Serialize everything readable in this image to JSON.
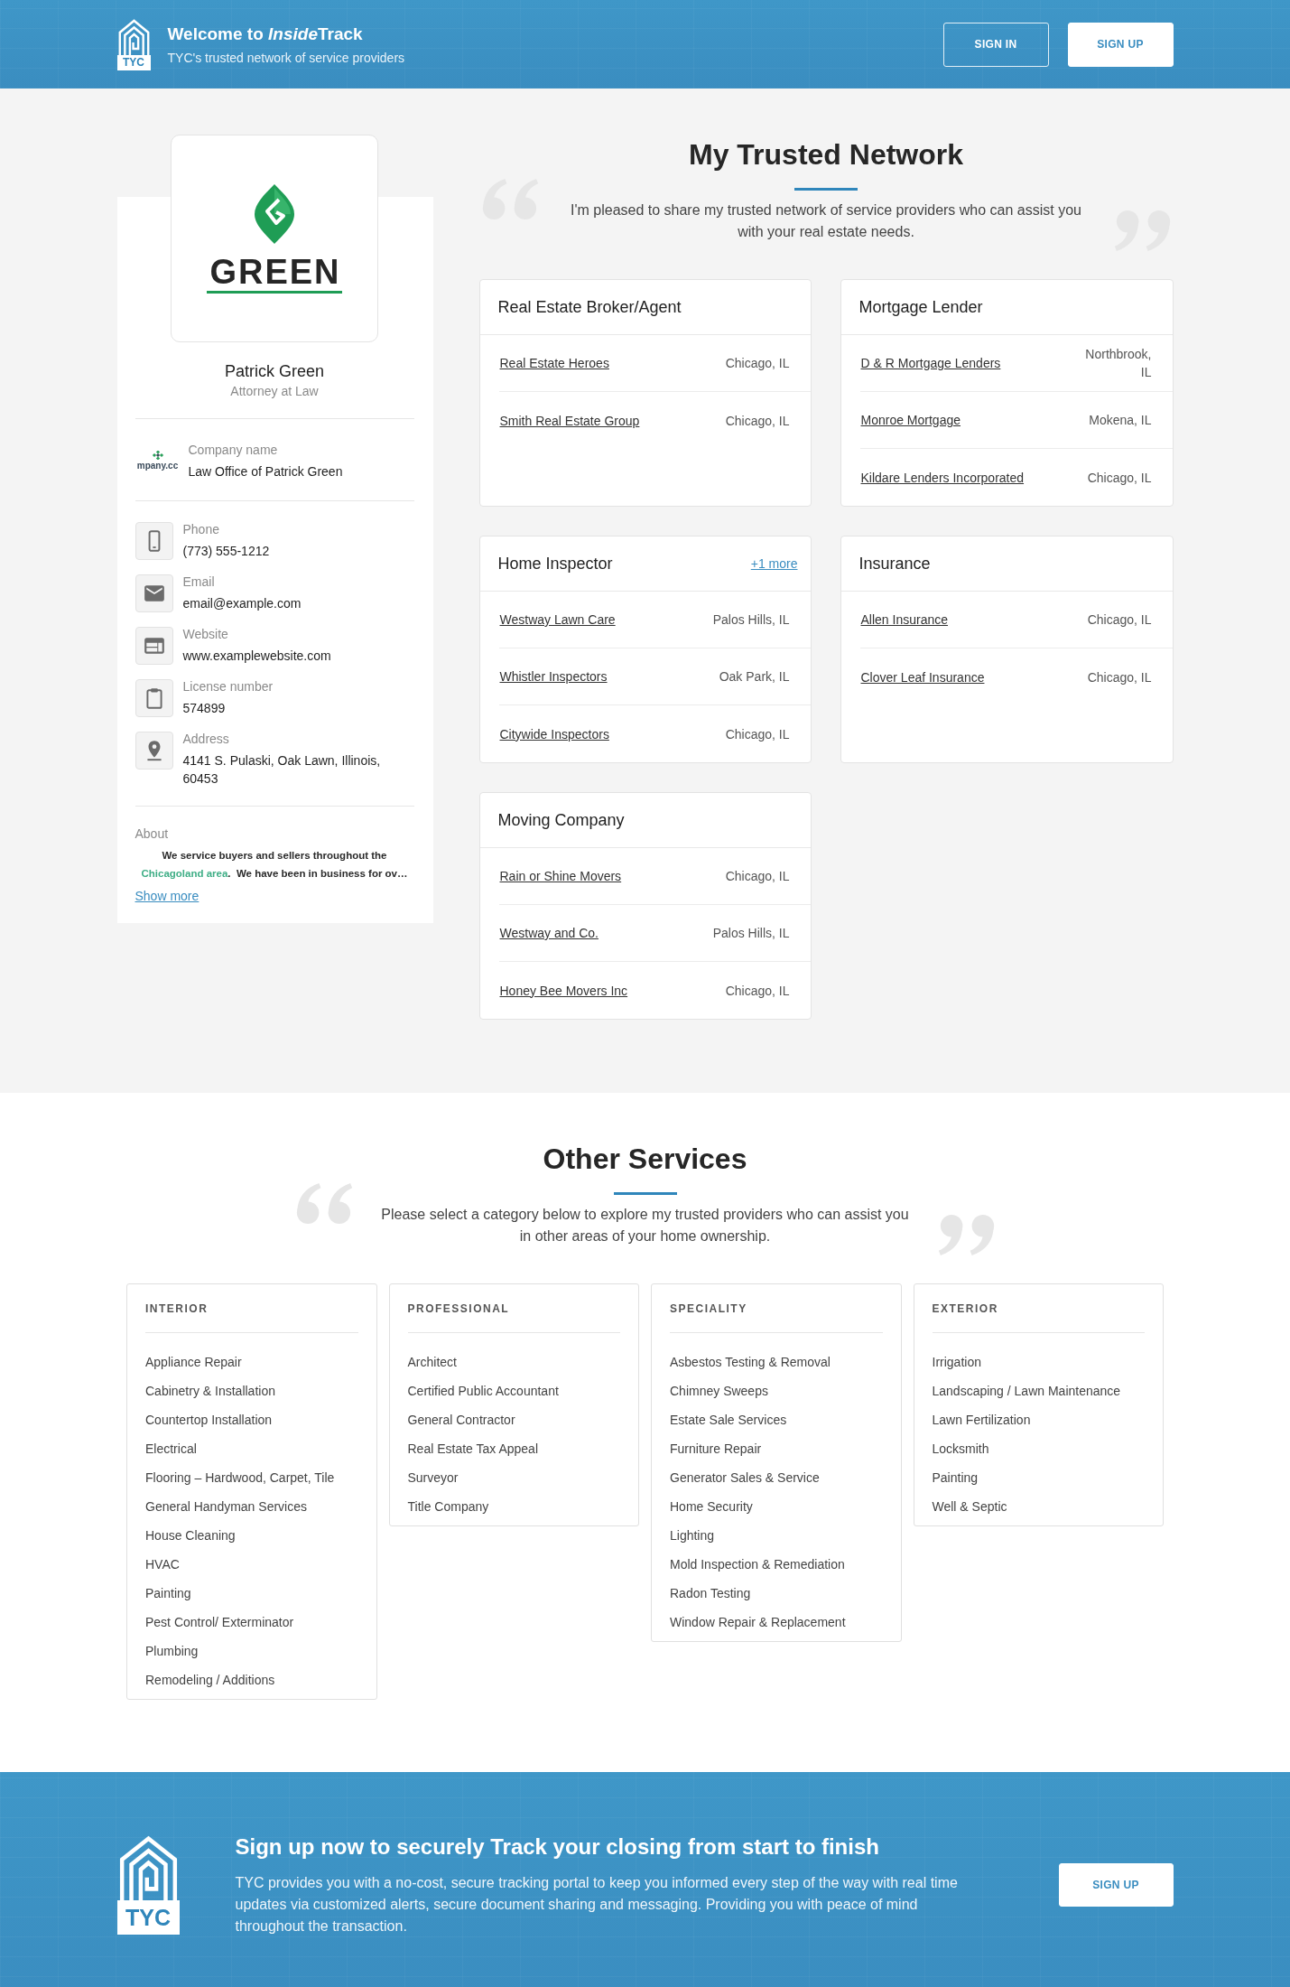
{
  "header": {
    "logo_text": "TYC",
    "title": [
      {
        "kind": "plain",
        "text": "Welcome to "
      },
      {
        "kind": "italic",
        "text": "Inside"
      },
      {
        "kind": "plain",
        "text": "Track"
      }
    ],
    "subtitle": "TYC's trusted network of service providers",
    "buttons": [
      {
        "kind": "outline",
        "label": "SIGN IN"
      },
      {
        "kind": "solid",
        "label": "SIGN UP"
      }
    ]
  },
  "profile": {
    "logo_text": "GREEN",
    "name": "Patrick Green",
    "role": "Attorney at Law",
    "company": {
      "logo_text": "mpany.cc",
      "label": "Company name",
      "value": "Law Office of Patrick Green"
    },
    "contacts": [
      {
        "kind": "phone",
        "label": "Phone",
        "value": "(773) 555-1212"
      },
      {
        "kind": "email",
        "label": "Email",
        "value": "email@example.com"
      },
      {
        "kind": "website",
        "label": "Website",
        "value": "www.examplewebsite.com"
      },
      {
        "kind": "license",
        "label": "License number",
        "value": "574899"
      },
      {
        "kind": "address",
        "label": "Address",
        "value": "4141 S. Pulaski, Oak Lawn, Illinois, 60453"
      }
    ],
    "about": {
      "label": "About",
      "text": [
        {
          "kind": "plain",
          "text": "We service buyers and sellers throughout the "
        },
        {
          "kind": "highlight",
          "text": "Chicagoland area"
        },
        {
          "kind": "plain",
          "text": ".  We have been in business for ov…"
        }
      ],
      "show_more": "Show more"
    }
  },
  "network": {
    "title": "My Trusted Network",
    "intro": "I'm pleased to share my trusted network of service providers who can assist you with your real estate needs.",
    "categories": [
      {
        "title": "Real Estate Broker/Agent",
        "providers": [
          {
            "name": "Real Estate Heroes",
            "location": "Chicago, IL"
          },
          {
            "name": "Smith Real Estate Group",
            "location": "Chicago, IL"
          }
        ]
      },
      {
        "title": "Mortgage Lender",
        "providers": [
          {
            "name": "D & R Mortgage Lenders",
            "location": "Northbrook, IL"
          },
          {
            "name": "Monroe Mortgage",
            "location": "Mokena, IL"
          },
          {
            "name": "Kildare Lenders Incorporated",
            "location": "Chicago, IL"
          }
        ]
      },
      {
        "title": "Home Inspector",
        "more": "+1 more",
        "providers": [
          {
            "name": "Westway Lawn Care",
            "location": "Palos Hills, IL"
          },
          {
            "name": "Whistler Inspectors",
            "location": "Oak Park, IL"
          },
          {
            "name": "Citywide Inspectors",
            "location": "Chicago, IL"
          }
        ]
      },
      {
        "title": "Insurance",
        "providers": [
          {
            "name": "Allen Insurance",
            "location": "Chicago, IL"
          },
          {
            "name": "Clover Leaf Insurance",
            "location": "Chicago, IL"
          }
        ]
      },
      {
        "title": "Moving Company",
        "providers": [
          {
            "name": "Rain or Shine Movers",
            "location": "Chicago, IL"
          },
          {
            "name": "Westway and Co.",
            "location": "Palos Hills, IL"
          },
          {
            "name": "Honey Bee Movers Inc",
            "location": "Chicago, IL"
          }
        ]
      }
    ]
  },
  "other_services": {
    "title": "Other Services",
    "intro": "Please select a category below to explore my trusted providers who can assist you in other areas of your home ownership.",
    "groups": [
      {
        "heading": "INTERIOR",
        "items": [
          "Appliance Repair",
          "Cabinetry & Installation",
          "Countertop Installation",
          "Electrical",
          "Flooring – Hardwood, Carpet, Tile",
          "General Handyman Services",
          "House Cleaning",
          "HVAC",
          "Painting",
          "Pest Control/ Exterminator",
          "Plumbing",
          "Remodeling / Additions"
        ]
      },
      {
        "heading": "PROFESSIONAL",
        "items": [
          "Architect",
          "Certified Public Accountant",
          "General Contractor",
          "Real Estate Tax Appeal",
          "Surveyor",
          "Title Company"
        ]
      },
      {
        "heading": "SPECIALITY",
        "items": [
          "Asbestos Testing & Removal",
          "Chimney Sweeps",
          "Estate Sale Services",
          "Furniture Repair",
          "Generator Sales & Service",
          "Home Security",
          "Lighting",
          "Mold Inspection & Remediation",
          "Radon Testing",
          "Window Repair & Replacement"
        ]
      },
      {
        "heading": "EXTERIOR",
        "items": [
          "Irrigation",
          "Landscaping / Lawn Maintenance",
          "Lawn Fertilization",
          "Locksmith",
          "Painting",
          "Well & Septic"
        ]
      }
    ]
  },
  "footer": {
    "logo_text": "TYC",
    "title": "Sign up now to securely Track your closing from start to finish",
    "text": "TYC provides you with a no-cost, secure tracking portal to keep you informed every step of the way with real time updates via customized alerts, secure document sharing and messaging. Providing you with peace of mind throughout the transaction.",
    "button": "SIGN UP"
  }
}
